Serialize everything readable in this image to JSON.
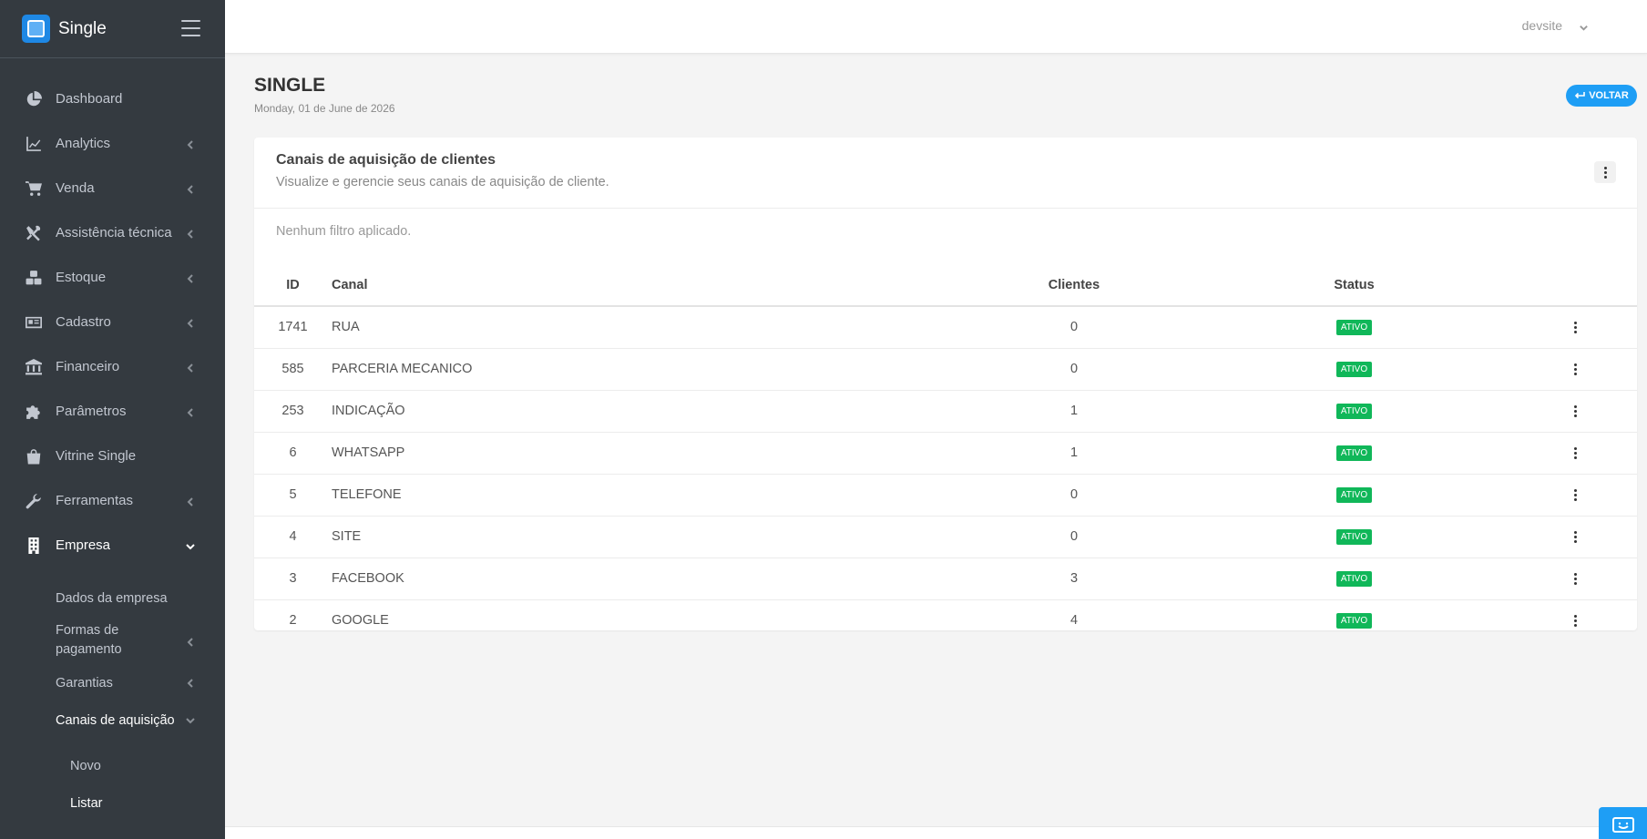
{
  "brand": {
    "name": "Single"
  },
  "sidebar": {
    "items": [
      {
        "label": "Dashboard",
        "icon": "chart-pie-icon"
      },
      {
        "label": "Analytics",
        "icon": "chart-line-icon"
      },
      {
        "label": "Venda",
        "icon": "shopping-cart-icon"
      },
      {
        "label": "Assistência técnica",
        "icon": "tools-icon"
      },
      {
        "label": "Estoque",
        "icon": "boxes-icon"
      },
      {
        "label": "Cadastro",
        "icon": "id-card-icon"
      },
      {
        "label": "Financeiro",
        "icon": "bank-icon"
      },
      {
        "label": "Parâmetros",
        "icon": "puzzle-icon"
      },
      {
        "label": "Vitrine Single",
        "icon": "shopping-bag-icon"
      },
      {
        "label": "Ferramentas",
        "icon": "wrench-icon"
      },
      {
        "label": "Empresa",
        "icon": "building-icon"
      }
    ],
    "empresa_sub": [
      {
        "label": "Dados da empresa"
      },
      {
        "label": "Formas de pagamento"
      },
      {
        "label": "Garantias"
      },
      {
        "label": "Canais de aquisição"
      }
    ],
    "canais_sub": [
      {
        "label": "Novo"
      },
      {
        "label": "Listar"
      }
    ]
  },
  "topbar": {
    "user": "devsite"
  },
  "page": {
    "title": "SINGLE",
    "date": "Monday, 01 de June de 2026",
    "back_label": "VOLTAR"
  },
  "card": {
    "title": "Canais de aquisição de clientes",
    "subtitle": "Visualize e gerencie seus canais de aquisição de cliente.",
    "filter_text": "Nenhum filtro aplicado."
  },
  "table": {
    "columns": {
      "id": "ID",
      "canal": "Canal",
      "clientes": "Clientes",
      "status": "Status"
    },
    "rows": [
      {
        "id": "1741",
        "canal": "RUA",
        "clientes": "0",
        "status": "ATIVO"
      },
      {
        "id": "585",
        "canal": "PARCERIA MECANICO",
        "clientes": "0",
        "status": "ATIVO"
      },
      {
        "id": "253",
        "canal": "INDICAÇÃO",
        "clientes": "1",
        "status": "ATIVO"
      },
      {
        "id": "6",
        "canal": "WHATSAPP",
        "clientes": "1",
        "status": "ATIVO"
      },
      {
        "id": "5",
        "canal": "TELEFONE",
        "clientes": "0",
        "status": "ATIVO"
      },
      {
        "id": "4",
        "canal": "SITE",
        "clientes": "0",
        "status": "ATIVO"
      },
      {
        "id": "3",
        "canal": "FACEBOOK",
        "clientes": "3",
        "status": "ATIVO"
      },
      {
        "id": "2",
        "canal": "GOOGLE",
        "clientes": "4",
        "status": "ATIVO"
      }
    ]
  },
  "colors": {
    "sidebar_bg": "#343a40",
    "accent": "#1e9ef5",
    "badge": "#10b759"
  }
}
